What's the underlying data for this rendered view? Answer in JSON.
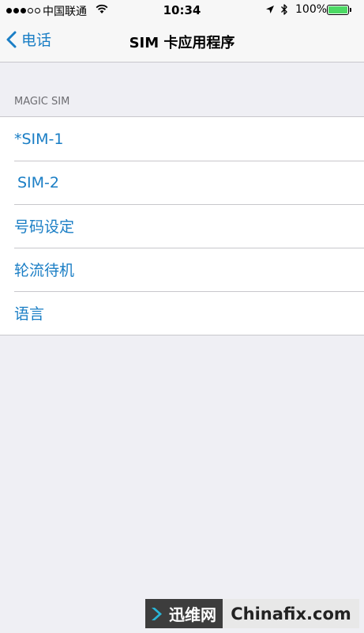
{
  "status_bar": {
    "carrier": "中国联通",
    "time": "10:34",
    "battery_percent": "100%",
    "battery_level": 1.0,
    "signal_bars_filled": 3,
    "signal_bars_total": 5
  },
  "nav": {
    "back_label": "电话",
    "title": "SIM 卡应用程序"
  },
  "section": {
    "header": "MAGIC SIM",
    "items": [
      {
        "label": "*SIM-1"
      },
      {
        "label": "SIM-2"
      },
      {
        "label": "号码设定"
      },
      {
        "label": "轮流待机"
      },
      {
        "label": "语言"
      }
    ]
  },
  "watermark": {
    "left_text": "迅维网",
    "right_text": "Chinafix.com"
  },
  "colors": {
    "accent": "#1a7ec5",
    "background": "#efeff4",
    "battery": "#4cd964"
  },
  "icons": [
    "wifi-icon",
    "location-icon",
    "bluetooth-icon",
    "battery-icon",
    "chevron-left-icon",
    "chinafix-logo-icon"
  ]
}
